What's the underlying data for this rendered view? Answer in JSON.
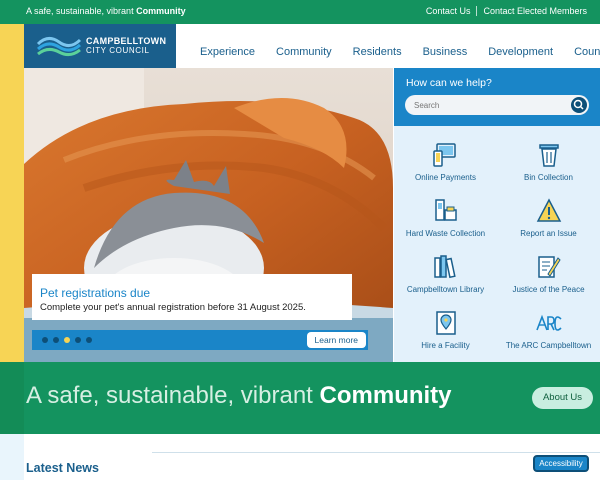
{
  "topbar": {
    "tagline_prefix": "A safe, sustainable, vibrant ",
    "tagline_bold": "Community",
    "contact_link": "Contact Us",
    "elected_link": "Contact Elected Members"
  },
  "logo": {
    "line1": "CAMPBELLTOWN",
    "line2": "CITY COUNCIL"
  },
  "nav": {
    "items": [
      "Experience",
      "Community",
      "Residents",
      "Business",
      "Development",
      "Council"
    ]
  },
  "hero": {
    "title": "Pet registrations due",
    "description": "Complete your pet's annual registration before 31 August 2025.",
    "cta": "Learn more",
    "slide_count": 5,
    "active_slide": 3
  },
  "help": {
    "heading": "How can we help?",
    "search_placeholder": "Search"
  },
  "quick_links": [
    {
      "label": "Online Payments",
      "icon": "payments-icon"
    },
    {
      "label": "Bin Collection",
      "icon": "bin-icon"
    },
    {
      "label": "Hard Waste Collection",
      "icon": "hard-waste-icon"
    },
    {
      "label": "Report an Issue",
      "icon": "warning-icon"
    },
    {
      "label": "Campbelltown Library",
      "icon": "library-icon"
    },
    {
      "label": "Justice of the Peace",
      "icon": "document-pen-icon"
    },
    {
      "label": "Hire a Facility",
      "icon": "location-icon"
    },
    {
      "label": "The ARC Campbelltown",
      "icon": "arc-logo-icon"
    }
  ],
  "banner": {
    "text_prefix": "A safe, sustainable, vibrant ",
    "text_bold": "Community",
    "button": "About Us"
  },
  "news": {
    "title": "Latest News"
  },
  "accessibility": {
    "label": "Accessibility"
  },
  "colors": {
    "green": "#14935f",
    "blue": "#1a85c8",
    "navy": "#1a5f8c",
    "yellow": "#f7d455",
    "light_blue": "#e3f1fb"
  }
}
